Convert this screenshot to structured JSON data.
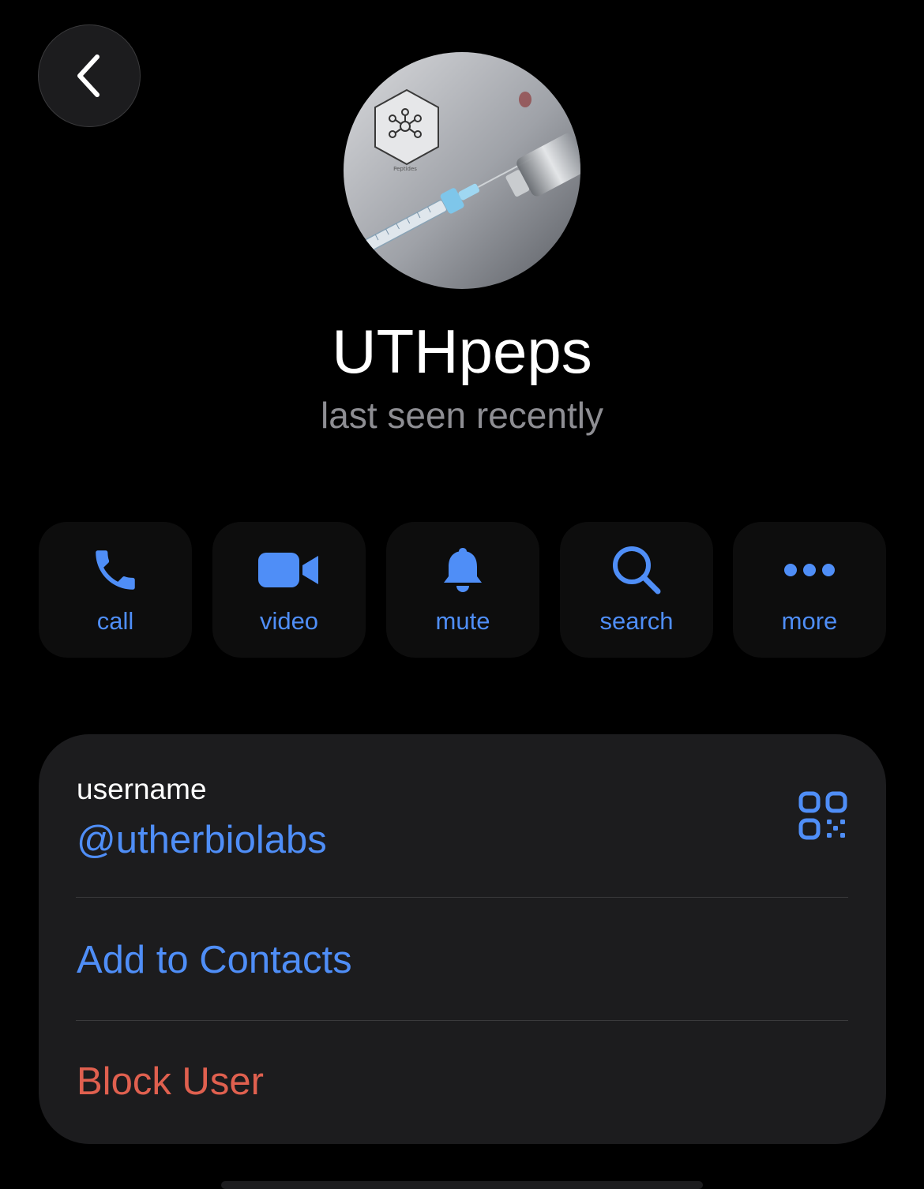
{
  "header": {
    "back_icon": "chevron-left-icon"
  },
  "profile": {
    "name": "UTHpeps",
    "status": "last seen recently",
    "avatar_caption": "Peptides"
  },
  "actions": [
    {
      "label": "call",
      "icon": "phone-icon"
    },
    {
      "label": "video",
      "icon": "video-camera-icon"
    },
    {
      "label": "mute",
      "icon": "bell-icon"
    },
    {
      "label": "search",
      "icon": "search-icon"
    },
    {
      "label": "more",
      "icon": "more-dots-icon"
    }
  ],
  "info": {
    "username_label": "username",
    "username_value": "@utherbiolabs",
    "qr_icon": "qr-code-icon",
    "add_to_contacts": "Add to Contacts",
    "block_user": "Block User"
  },
  "colors": {
    "background": "#000000",
    "accent": "#4f8ef7",
    "destructive": "#e0604f",
    "secondary_text": "#8e8e93",
    "card": "#1c1c1e"
  }
}
